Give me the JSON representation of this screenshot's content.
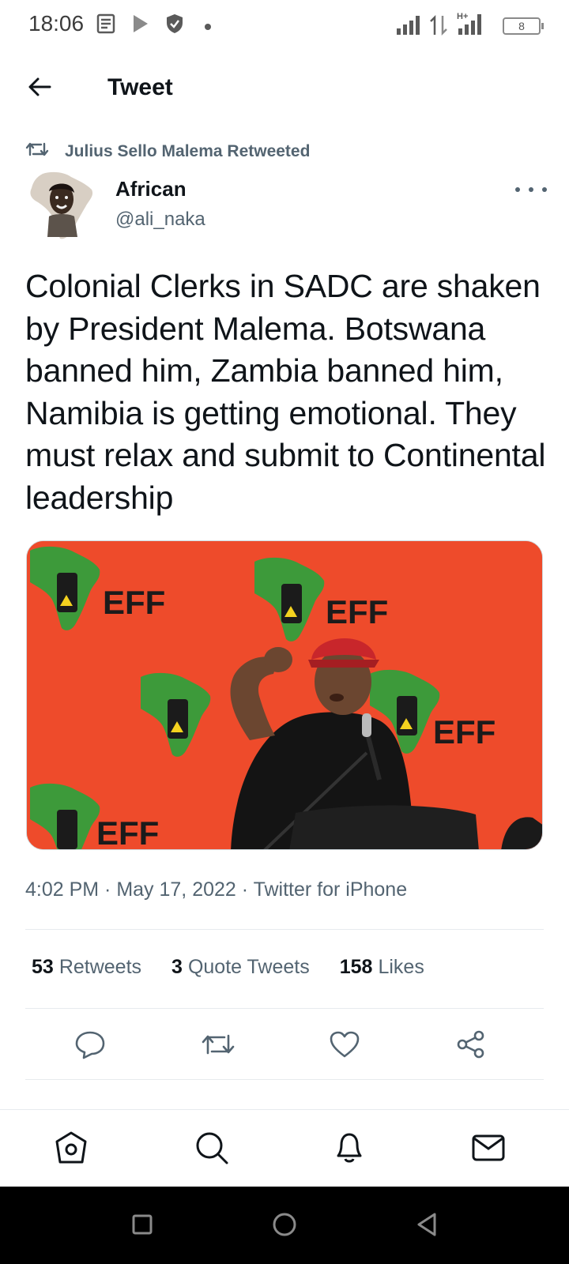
{
  "status_bar": {
    "time": "18:06",
    "battery": "8",
    "network_label": "H+"
  },
  "header": {
    "title": "Tweet",
    "back_icon": "arrow-left-icon"
  },
  "retweet_context": {
    "text": "Julius Sello Malema Retweeted",
    "icon": "retweet-icon"
  },
  "author": {
    "name": "African",
    "handle": "@ali_naka"
  },
  "tweet": {
    "text": "Colonial Clerks in SADC are shaken by President Malema. Botswana banned him, Zambia banned him, Namibia is getting emotional. They must relax and submit to Continental leadership",
    "media": {
      "banner_label": "EFF",
      "background_color": "#ee4b2b",
      "map_color": "#3d9a3a"
    },
    "meta": "4:02 PM · May 17, 2022 · Twitter for iPhone"
  },
  "stats": [
    {
      "count": "53",
      "label": "Retweets"
    },
    {
      "count": "3",
      "label": "Quote Tweets"
    },
    {
      "count": "158",
      "label": "Likes"
    }
  ],
  "actions": [
    {
      "icon": "reply-icon"
    },
    {
      "icon": "retweet-icon"
    },
    {
      "icon": "like-heart-icon"
    },
    {
      "icon": "share-icon"
    }
  ],
  "bottom_nav": [
    {
      "icon": "home-icon"
    },
    {
      "icon": "search-icon"
    },
    {
      "icon": "notifications-bell-icon"
    },
    {
      "icon": "messages-envelope-icon"
    }
  ],
  "system_nav": [
    {
      "icon": "recents-square-icon"
    },
    {
      "icon": "home-circle-icon"
    },
    {
      "icon": "back-triangle-icon"
    }
  ],
  "colors": {
    "text_primary": "#0f1419",
    "text_secondary": "#536471",
    "divider": "#e7ebee"
  }
}
